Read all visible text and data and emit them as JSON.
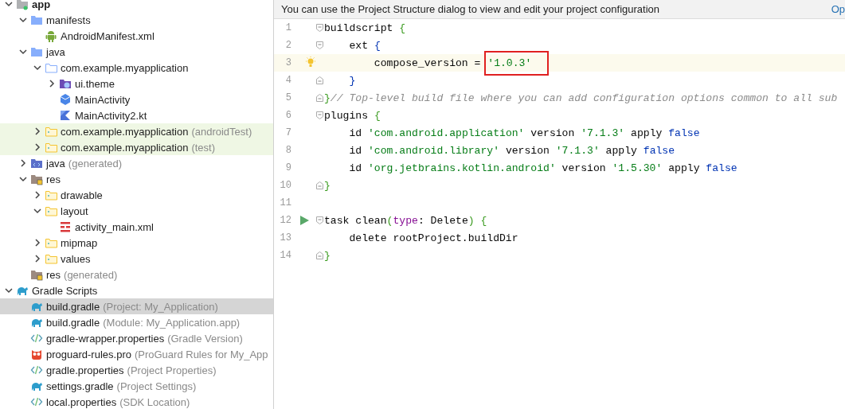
{
  "project_tree": [
    {
      "label": "app",
      "kind": "module",
      "expanded": true,
      "selected": false,
      "tinted": false,
      "children": [
        {
          "label": "manifests",
          "kind": "folder",
          "expanded": true,
          "selected": false,
          "tinted": false,
          "children": [
            {
              "label": "AndroidManifest.xml",
              "kind": "android",
              "selected": false,
              "tinted": false
            }
          ]
        },
        {
          "label": "java",
          "kind": "folder",
          "expanded": true,
          "selected": false,
          "tinted": false,
          "children": [
            {
              "label": "com.example.myapplication",
              "kind": "package",
              "expanded": true,
              "selected": false,
              "tinted": false,
              "children": [
                {
                  "label": "ui.theme",
                  "kind": "theme",
                  "expanded": false,
                  "selected": false,
                  "tinted": false
                },
                {
                  "label": "MainActivity",
                  "kind": "class",
                  "selected": false,
                  "tinted": false
                },
                {
                  "label": "MainActivity2.kt",
                  "kind": "kotlin",
                  "selected": false,
                  "tinted": false
                }
              ]
            },
            {
              "label": "com.example.myapplication",
              "note": "(androidTest)",
              "kind": "source",
              "expanded": false,
              "selected": false,
              "tinted": true
            },
            {
              "label": "com.example.myapplication",
              "note": "(test)",
              "kind": "source",
              "expanded": false,
              "selected": false,
              "tinted": true
            }
          ]
        },
        {
          "label": "java",
          "note": "(generated)",
          "kind": "generated",
          "expanded": false,
          "selected": false,
          "tinted": false
        },
        {
          "label": "res",
          "kind": "res",
          "expanded": true,
          "selected": false,
          "tinted": false,
          "children": [
            {
              "label": "drawable",
              "kind": "source",
              "expanded": false,
              "selected": false,
              "tinted": false
            },
            {
              "label": "layout",
              "kind": "source",
              "expanded": true,
              "selected": false,
              "tinted": false,
              "children": [
                {
                  "label": "activity_main.xml",
                  "kind": "layout",
                  "selected": false,
                  "tinted": false
                }
              ]
            },
            {
              "label": "mipmap",
              "kind": "source",
              "expanded": false,
              "selected": false,
              "tinted": false
            },
            {
              "label": "values",
              "kind": "source",
              "expanded": false,
              "selected": false,
              "tinted": false
            }
          ]
        },
        {
          "label": "res",
          "note": "(generated)",
          "kind": "res",
          "selected": false,
          "tinted": false
        }
      ]
    },
    {
      "label": "Gradle Scripts",
      "kind": "gradle",
      "expanded": true,
      "selected": false,
      "tinted": false,
      "children": [
        {
          "label": "build.gradle",
          "note": "(Project: My_Application)",
          "kind": "gradle",
          "selected": true,
          "tinted": false
        },
        {
          "label": "build.gradle",
          "note": "(Module: My_Application.app)",
          "kind": "gradle",
          "selected": false,
          "tinted": false
        },
        {
          "label": "gradle-wrapper.properties",
          "note": "(Gradle Version)",
          "kind": "properties",
          "selected": false,
          "tinted": false
        },
        {
          "label": "proguard-rules.pro",
          "note": "(ProGuard Rules for My_App",
          "kind": "proguard",
          "selected": false,
          "tinted": false
        },
        {
          "label": "gradle.properties",
          "note": "(Project Properties)",
          "kind": "properties",
          "selected": false,
          "tinted": false
        },
        {
          "label": "settings.gradle",
          "note": "(Project Settings)",
          "kind": "gradle",
          "selected": false,
          "tinted": false
        },
        {
          "label": "local.properties",
          "note": "(SDK Location)",
          "kind": "properties",
          "selected": false,
          "tinted": false
        }
      ]
    }
  ],
  "editor": {
    "banner": {
      "text": "You can use the Project Structure dialog to view and edit your project configuration",
      "link": "Op"
    },
    "lines": [
      {
        "number": "1",
        "fold_start": true,
        "current": false,
        "tokens": [
          {
            "kind": "plain",
            "text": "buildscript "
          },
          {
            "kind": "brace",
            "text": "{"
          }
        ]
      },
      {
        "number": "2",
        "fold_start": true,
        "current": false,
        "tokens": [
          {
            "kind": "plain",
            "text": "    ext "
          },
          {
            "kind": "bracket",
            "text": "{"
          }
        ]
      },
      {
        "number": "3",
        "current": true,
        "intention_bulb": true,
        "tokens": [
          {
            "kind": "plain",
            "text": "        compose_version = "
          },
          {
            "kind": "string",
            "text": "'1.0.3'",
            "boxed": true
          }
        ]
      },
      {
        "number": "4",
        "fold_end": true,
        "current": false,
        "tokens": [
          {
            "kind": "bracket",
            "text": "    }"
          }
        ]
      },
      {
        "number": "5",
        "fold_end": true,
        "current": false,
        "tokens": [
          {
            "kind": "brace",
            "text": "}"
          },
          {
            "kind": "comment",
            "text": "// Top-level build file where you can add configuration options common to all sub"
          }
        ]
      },
      {
        "number": "6",
        "fold_start": true,
        "current": false,
        "tokens": [
          {
            "kind": "plain",
            "text": "plugins "
          },
          {
            "kind": "brace",
            "text": "{"
          }
        ]
      },
      {
        "number": "7",
        "current": false,
        "tokens": [
          {
            "kind": "plain",
            "text": "    id "
          },
          {
            "kind": "string",
            "text": "'com.android.application'"
          },
          {
            "kind": "plain",
            "text": " version "
          },
          {
            "kind": "string",
            "text": "'7.1.3'"
          },
          {
            "kind": "plain",
            "text": " apply "
          },
          {
            "kind": "keyword",
            "text": "false"
          }
        ]
      },
      {
        "number": "8",
        "current": false,
        "tokens": [
          {
            "kind": "plain",
            "text": "    id "
          },
          {
            "kind": "string",
            "text": "'com.android.library'"
          },
          {
            "kind": "plain",
            "text": " version "
          },
          {
            "kind": "string",
            "text": "'7.1.3'"
          },
          {
            "kind": "plain",
            "text": " apply "
          },
          {
            "kind": "keyword",
            "text": "false"
          }
        ]
      },
      {
        "number": "9",
        "current": false,
        "tokens": [
          {
            "kind": "plain",
            "text": "    id "
          },
          {
            "kind": "string",
            "text": "'org.jetbrains.kotlin.android'"
          },
          {
            "kind": "plain",
            "text": " version "
          },
          {
            "kind": "string",
            "text": "'1.5.30'"
          },
          {
            "kind": "plain",
            "text": " apply "
          },
          {
            "kind": "keyword",
            "text": "false"
          }
        ]
      },
      {
        "number": "10",
        "fold_end": true,
        "current": false,
        "tokens": [
          {
            "kind": "brace",
            "text": "}"
          }
        ]
      },
      {
        "number": "11",
        "current": false
      },
      {
        "number": "12",
        "fold_start": true,
        "current": false,
        "run_button": true,
        "tokens": [
          {
            "kind": "plain",
            "text": "task clean"
          },
          {
            "kind": "paren",
            "text": "("
          },
          {
            "kind": "param",
            "text": "type"
          },
          {
            "kind": "plain",
            "text": ": Delete"
          },
          {
            "kind": "paren",
            "text": ") "
          },
          {
            "kind": "brace",
            "text": "{"
          }
        ]
      },
      {
        "number": "13",
        "current": false,
        "tokens": [
          {
            "kind": "plain",
            "text": "    delete rootProject.buildDir"
          }
        ]
      },
      {
        "number": "14",
        "fold_end": true,
        "current": false,
        "tokens": [
          {
            "kind": "brace",
            "text": "}"
          }
        ]
      }
    ]
  }
}
